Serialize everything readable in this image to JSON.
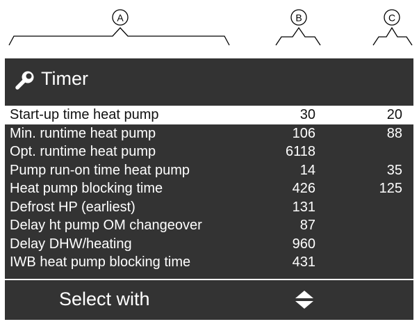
{
  "annotations": {
    "callout_a": "A",
    "callout_b": "B",
    "callout_c": "C"
  },
  "header": {
    "title": "Timer",
    "icon": "wrench-icon"
  },
  "rows": [
    {
      "label": "Start-up time heat pump",
      "b": "30",
      "c": "20",
      "selected": true
    },
    {
      "label": "Min. runtime heat pump",
      "b": "106",
      "c": "88"
    },
    {
      "label": "Opt. runtime heat pump",
      "b": "6118",
      "c": ""
    },
    {
      "label": "Pump run-on time heat pump",
      "b": "14",
      "c": "35"
    },
    {
      "label": "Heat pump blocking time",
      "b": "426",
      "c": "125"
    },
    {
      "label": "Defrost HP (earliest)",
      "b": "131",
      "c": ""
    },
    {
      "label": "Delay ht pump OM changeover",
      "b": "87",
      "c": ""
    },
    {
      "label": "Delay DHW/heating",
      "b": "960",
      "c": ""
    },
    {
      "label": "IWB heat pump blocking time",
      "b": "431",
      "c": ""
    }
  ],
  "footer": {
    "hint": "Select with",
    "icon": "up-down-arrows-icon"
  },
  "colors": {
    "screen_bg": "#333333",
    "text": "#ffffff",
    "selected_bg": "#ffffff",
    "selected_text": "#111111"
  }
}
